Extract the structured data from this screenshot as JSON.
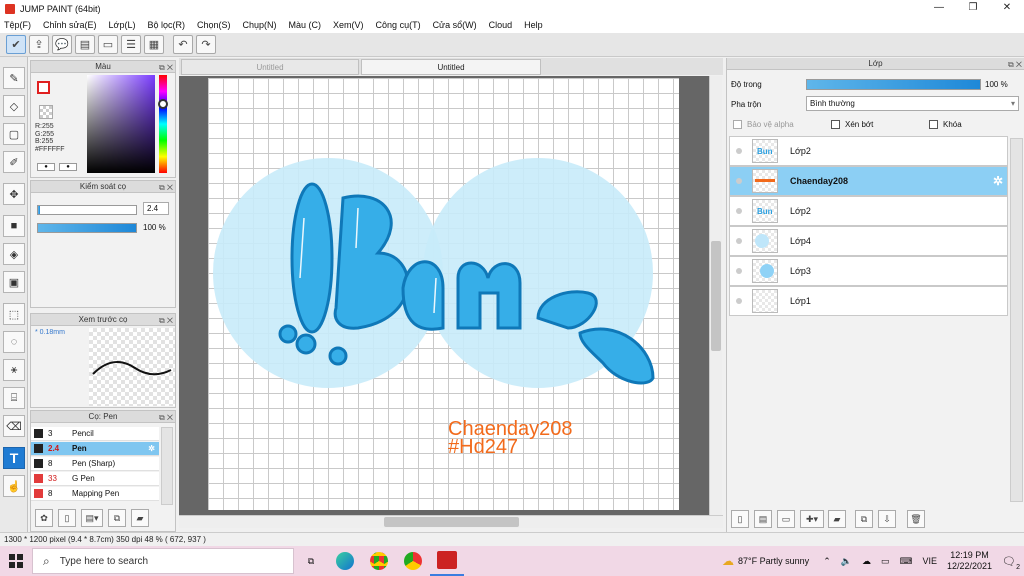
{
  "window": {
    "title": "JUMP PAINT (64bit)",
    "minimize": "—",
    "restore": "❐",
    "close": "✕"
  },
  "menu": [
    "Tệp(F)",
    "Chỉnh sửa(E)",
    "Lớp(L)",
    "Bộ lọc(R)",
    "Chọn(S)",
    "Chụp(N)",
    "Màu (C)",
    "Xem(V)",
    "Công cụ(T)",
    "Cửa sổ(W)",
    "Cloud",
    "Help"
  ],
  "color_panel": {
    "title": "Màu",
    "r": "R:255",
    "g": "G:255",
    "b": "B:255",
    "hex": "#FFFFFF",
    "fg_color": "#FFFFFF",
    "bg_color": "#46A7E6"
  },
  "brush_control": {
    "title": "Kiểm soát cọ",
    "size_value": "2.4",
    "opacity_value": "100 %",
    "opacity_fraction": 1.0,
    "size_fraction": 0.02
  },
  "preview": {
    "title": "Xem trước cọ",
    "size_label": "0.18mm"
  },
  "brush_list": {
    "title": "Cọ: Pen",
    "items": [
      {
        "size": "3",
        "name": "Pencil",
        "color": "#222222"
      },
      {
        "size": "2.4",
        "name": "Pen",
        "color": "#222222",
        "selected": true
      },
      {
        "size": "8",
        "name": "Pen (Sharp)",
        "color": "#222222"
      },
      {
        "size": "33",
        "name": "G Pen",
        "color": "#e23b3b"
      },
      {
        "size": "8",
        "name": "Mapping Pen",
        "color": "#e23b3b"
      }
    ]
  },
  "tabs": [
    "Untitled",
    "Untitled"
  ],
  "canvas": {
    "lettering": "Bun",
    "watermark_line1": "Chaenday208",
    "watermark_line2": "#Hd247",
    "circle_color": "#c8ebfa",
    "letter_fill": "#36aee8",
    "letter_stroke": "#0f78b8",
    "watermark_color": "#f26a1b"
  },
  "layer_panel": {
    "title": "Lớp",
    "opacity_label": "Độ trong",
    "opacity_value": "100 %",
    "opacity_fraction": 1.0,
    "blend_label": "Pha trộn",
    "blend_value": "Bình thường",
    "protect_alpha": "Bảo vệ alpha",
    "clipping": "Xén bớt",
    "lock": "Khóa",
    "layers": [
      {
        "name": "Lớp2",
        "selected": false
      },
      {
        "name": "Chaenday208",
        "selected": true
      },
      {
        "name": "Lớp2",
        "selected": false
      },
      {
        "name": "Lớp4",
        "selected": false
      },
      {
        "name": "Lớp3",
        "selected": false
      },
      {
        "name": "Lớp1",
        "selected": false
      }
    ]
  },
  "status": {
    "text": "1300 * 1200 pixel  (9.4 * 8.7cm)  350 dpi  48 %  ( 672, 937 )"
  },
  "taskbar": {
    "search_placeholder": "Type here to search",
    "weather": "87°F  Partly sunny",
    "lang": "VIE",
    "time": "12:19 PM",
    "date": "12/22/2021",
    "notifications": "2"
  }
}
